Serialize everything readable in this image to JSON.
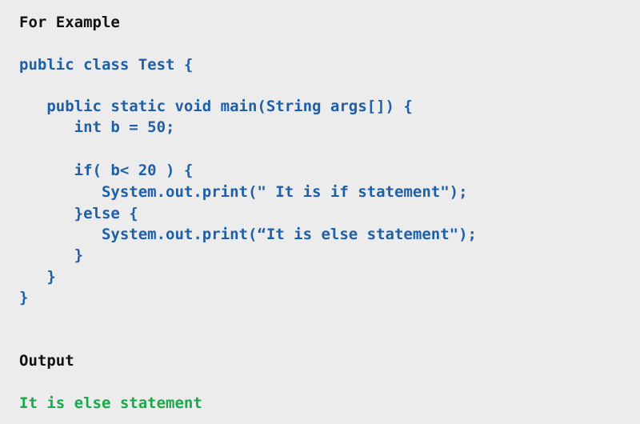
{
  "example_heading": "For Example",
  "code_lines": [
    "public class Test {",
    "",
    "   public static void main(String args[]) {",
    "      int b = 50;",
    "",
    "      if( b< 20 ) {",
    "         System.out.print(\" It is if statement\");",
    "      }else {",
    "         System.out.print(“It is else statement\");",
    "      }",
    "   }",
    "}"
  ],
  "output_heading": "Output",
  "output_text": "It is else statement",
  "colors": {
    "background": "#ececec",
    "heading": "#111111",
    "code": "#1f5fa8",
    "output": "#19a84a"
  }
}
